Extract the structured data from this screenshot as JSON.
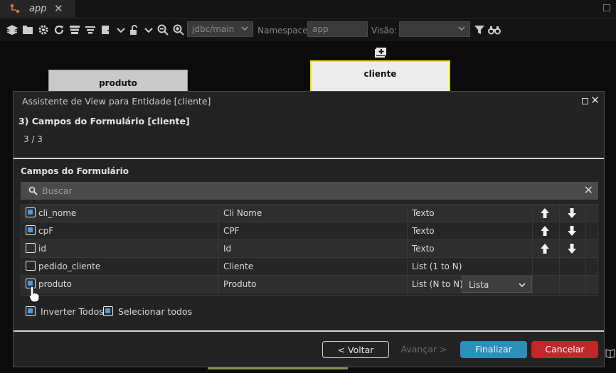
{
  "tab": {
    "label": "app"
  },
  "toolbar": {
    "connection": "jdbc/main",
    "namespace_label": "Namespace",
    "namespace_value": "app",
    "view_label": "Visão:",
    "view_value": ""
  },
  "canvas": {
    "entities": [
      {
        "name": "produto"
      },
      {
        "name": "cliente"
      }
    ]
  },
  "modal": {
    "title": "Assistente de View para Entidade [cliente]",
    "step_title": "3) Campos do Formulário [cliente]",
    "step_count": "3 / 3",
    "section_title": "Campos do Formulário",
    "search_placeholder": "Buscar",
    "rows": [
      {
        "field": "cli_nome",
        "label": "Cli Nome",
        "type": "Texto",
        "checked": true,
        "arrows": true
      },
      {
        "field": "cpF",
        "label": "CPF",
        "type": "Texto",
        "checked": true,
        "arrows": true
      },
      {
        "field": "id",
        "label": "Id",
        "type": "Texto",
        "checked": false,
        "arrows": true
      },
      {
        "field": "pedido_cliente",
        "label": "Cliente",
        "type": "List (1 to N)",
        "checked": false,
        "arrows": false
      },
      {
        "field": "produto",
        "label": "Produto",
        "type": "List (N to N)",
        "checked": true,
        "arrows": false,
        "widget": "Lista"
      }
    ],
    "invert_all_label": "Inverter Todos",
    "select_all_label": "Selecionar todos",
    "buttons": {
      "back": "< Voltar",
      "next": "Avançar >",
      "finish": "Finalizar",
      "cancel": "Cancelar"
    }
  },
  "colors": {
    "accent": "#2b8fb9",
    "danger": "#c3262b",
    "selected_entity_border": "#f2e600",
    "checkbox_fill": "#4a9be0"
  }
}
